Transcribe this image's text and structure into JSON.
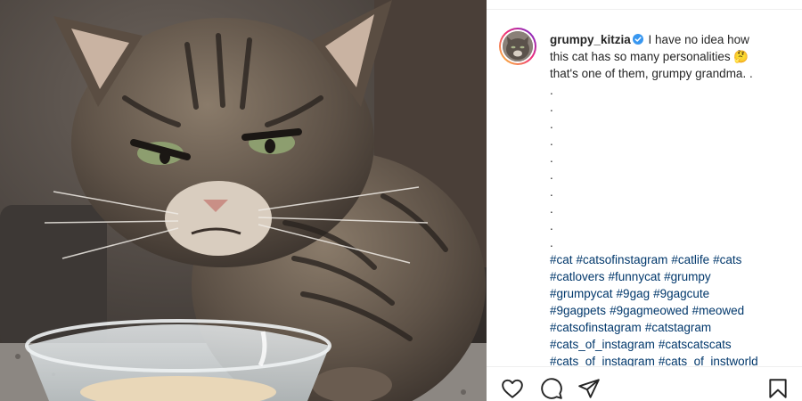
{
  "post": {
    "username": "grumpy_kitzia",
    "verified_icon": "verified-badge-icon",
    "caption_lines": [
      "I have no idea how",
      "this cat has so many personalities 🤔",
      "that's one of them, grumpy grandma. ."
    ],
    "dots": [
      ".",
      ".",
      ".",
      ".",
      ".",
      ".",
      ".",
      ".",
      ".",
      "."
    ],
    "hashtags": [
      "#cat",
      "#catsofinstagram",
      "#catlife",
      "#cats",
      "#catlovers",
      "#funnycat",
      "#grumpy",
      "#grumpycat",
      "#9gag",
      "#9gagcute",
      "#9gagpets",
      "#9gagmeowed",
      "#meowed",
      "#catsofinstagram",
      "#catstagram",
      "#cats_of_instagram",
      "#catscatscats",
      "#cats_of_instagram",
      "#cats_of_instworld"
    ]
  },
  "actions": {
    "like_icon": "heart-icon",
    "comment_icon": "comment-icon",
    "share_icon": "share-icon",
    "save_icon": "bookmark-icon"
  },
  "colors": {
    "text": "#262626",
    "hashtag": "#00376b",
    "verified": "#3897f0"
  }
}
